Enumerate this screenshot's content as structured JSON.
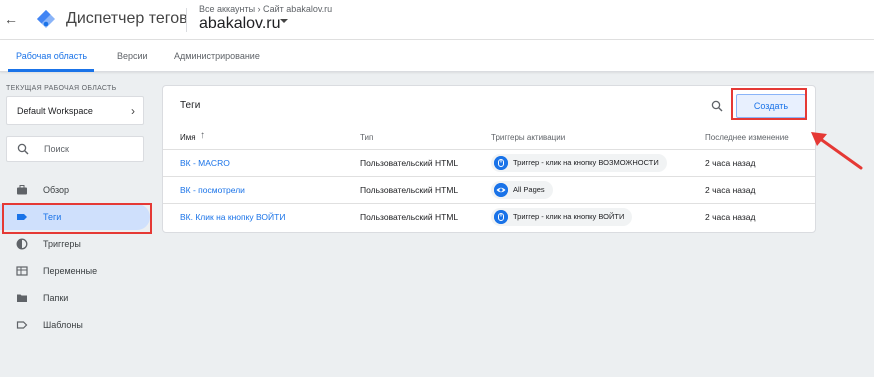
{
  "header": {
    "title": "Диспетчер тегов",
    "breadcrumbs": "Все аккаунты › Сайт abakalov.ru",
    "container": "abakalov.ru"
  },
  "tabs": [
    {
      "label": "Рабочая область",
      "active": true
    },
    {
      "label": "Версии",
      "active": false
    },
    {
      "label": "Администрирование",
      "active": false
    }
  ],
  "workspace": {
    "label": "ТЕКУЩАЯ РАБОЧАЯ ОБЛАСТЬ",
    "name": "Default Workspace"
  },
  "search": {
    "placeholder": "Поиск"
  },
  "nav": [
    {
      "label": "Обзор",
      "icon": "briefcase-icon"
    },
    {
      "label": "Теги",
      "icon": "tag-icon",
      "active": true
    },
    {
      "label": "Триггеры",
      "icon": "trigger-icon"
    },
    {
      "label": "Переменные",
      "icon": "variables-icon"
    },
    {
      "label": "Папки",
      "icon": "folder-icon"
    },
    {
      "label": "Шаблоны",
      "icon": "template-icon"
    }
  ],
  "tags_card": {
    "title": "Теги",
    "create_label": "Создать",
    "columns": {
      "name": "Имя",
      "type": "Тип",
      "triggers": "Триггеры активации",
      "modified": "Последнее изменение"
    },
    "rows": [
      {
        "name": "ВК - MACRO",
        "type": "Пользовательский HTML",
        "trigger": "Триггер - клик на кнопку ВОЗМОЖНОСТИ",
        "trigger_icon": "click-icon",
        "modified": "2 часа назад"
      },
      {
        "name": "ВК - посмотрели",
        "type": "Пользовательский HTML",
        "trigger": "All Pages",
        "trigger_icon": "eye-icon",
        "modified": "2 часа назад"
      },
      {
        "name": "ВК. Клик на кнопку ВОЙТИ",
        "type": "Пользовательский HTML",
        "trigger": "Триггер - клик на кнопку ВОЙТИ",
        "trigger_icon": "click-icon",
        "modified": "2 часа назад"
      }
    ]
  },
  "colors": {
    "accent": "#1a73e8",
    "highlight": "#e53935",
    "background": "#eceff1"
  }
}
